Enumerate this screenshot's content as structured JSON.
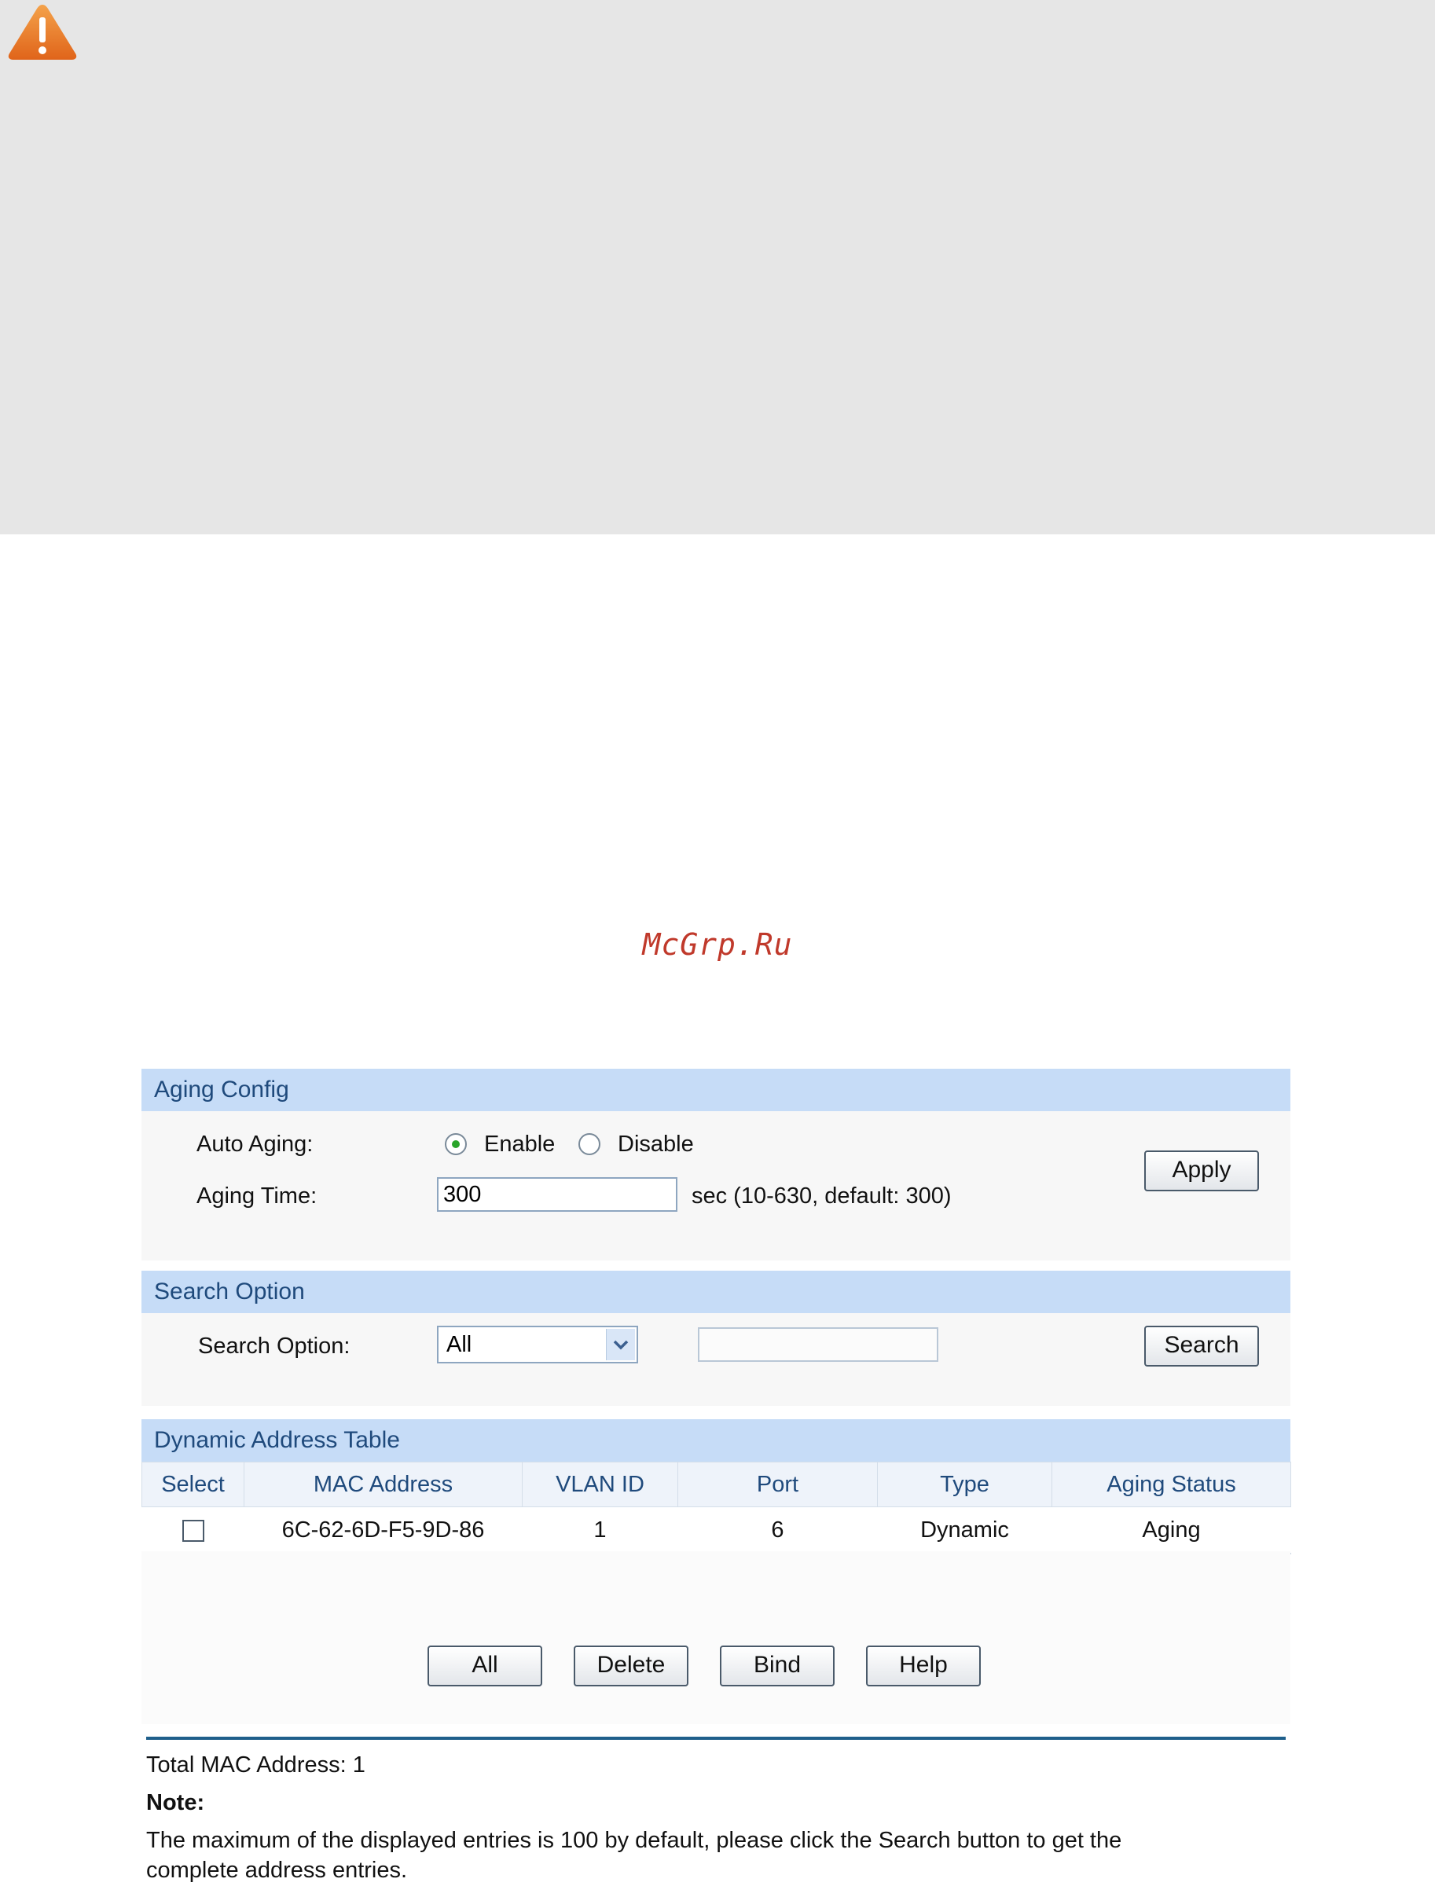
{
  "watermark": "McGrp.Ru",
  "aging_config": {
    "title": "Aging Config",
    "auto_aging_label": "Auto Aging:",
    "enable_label": "Enable",
    "disable_label": "Disable",
    "auto_aging_value": "Enable",
    "aging_time_label": "Aging Time:",
    "aging_time_value": "300",
    "aging_time_hint": "sec (10-630, default: 300)",
    "apply_label": "Apply"
  },
  "search_option": {
    "title": "Search Option",
    "label": "Search Option:",
    "selected": "All",
    "input_value": "",
    "search_label": "Search"
  },
  "dynamic_table": {
    "title": "Dynamic Address Table",
    "columns": [
      "Select",
      "MAC Address",
      "VLAN ID",
      "Port",
      "Type",
      "Aging Status"
    ],
    "rows": [
      {
        "selected": false,
        "mac": "6C-62-6D-F5-9D-86",
        "vlan": "1",
        "port": "6",
        "type": "Dynamic",
        "aging_status": "Aging"
      }
    ]
  },
  "buttons": {
    "all": "All",
    "delete": "Delete",
    "bind": "Bind",
    "help": "Help"
  },
  "footer": {
    "total": "Total MAC Address: 1",
    "note_title": "Note:",
    "note_line1": "The maximum of the displayed entries is 100 by default, please click the Search button to get the",
    "note_line2": "complete address entries."
  },
  "colors": {
    "section_header_bg": "#c6dcf7",
    "section_header_text": "#1f4a7c",
    "warning_orange": "#e8701e",
    "radio_selected": "#2aa52a",
    "watermark": "#c0392b"
  },
  "icons": {
    "warning": "warning-triangle-icon",
    "dropdown": "chevron-down-icon"
  }
}
